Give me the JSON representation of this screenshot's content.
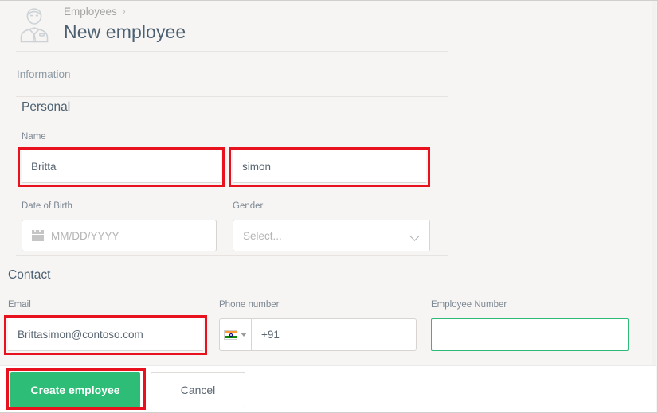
{
  "header": {
    "avatar_icon": "employee-avatar-icon",
    "breadcrumb_parent": "Employees",
    "breadcrumb_separator": "›",
    "title": "New employee"
  },
  "tabs": {
    "information_label": "Information"
  },
  "sections": {
    "personal": {
      "title": "Personal",
      "name_label": "Name",
      "first_name_value": "Britta",
      "first_name_placeholder": "",
      "last_name_value": "simon",
      "last_name_placeholder": "",
      "dob_label": "Date of Birth",
      "dob_value": "",
      "dob_placeholder": "MM/DD/YYYY",
      "dob_icon": "calendar-icon",
      "gender_label": "Gender",
      "gender_value": "Select...",
      "gender_caret_icon": "chevron-down-icon"
    },
    "contact": {
      "title": "Contact",
      "email_label": "Email",
      "email_value": "Brittasimon@contoso.com",
      "email_placeholder": "",
      "phone_label": "Phone number",
      "phone_country_flag": "india-flag-icon",
      "phone_country_caret_icon": "caret-down-icon",
      "phone_value": "+91",
      "phone_placeholder": "",
      "employee_number_label": "Employee Number",
      "employee_number_value": "",
      "employee_number_placeholder": ""
    }
  },
  "footer": {
    "create_label": "Create employee",
    "cancel_label": "Cancel"
  },
  "colors": {
    "accent_green": "#2ebd77",
    "focus_green": "#2fba7a",
    "annotation_red": "#e8121f",
    "page_background": "#f6f5f3",
    "title_text": "#4c6072"
  }
}
